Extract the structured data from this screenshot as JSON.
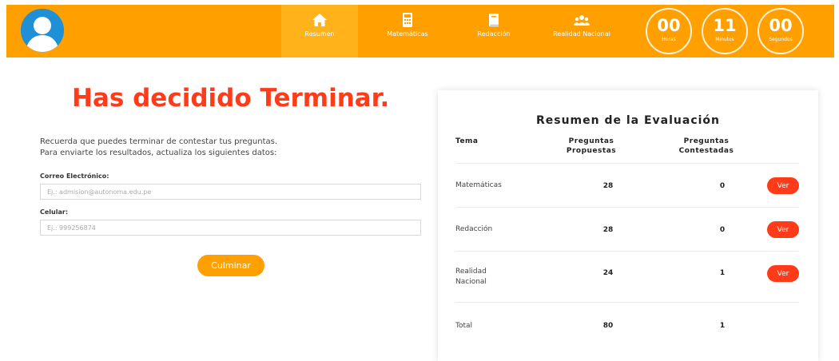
{
  "header": {
    "nav": [
      {
        "label": "Resumen",
        "icon": "home-icon"
      },
      {
        "label": "Matemáticas",
        "icon": "calculator-icon"
      },
      {
        "label": "Redacción",
        "icon": "book-icon"
      },
      {
        "label": "Realidad Nacional",
        "icon": "users-icon"
      }
    ],
    "timer": [
      {
        "value": "00",
        "unit": "Horas"
      },
      {
        "value": "11",
        "unit": "Minutos"
      },
      {
        "value": "00",
        "unit": "Segundos"
      }
    ]
  },
  "main": {
    "title": "Has decidido Terminar.",
    "intro_line1": "Recuerda que puedes terminar de contestar tus preguntas.",
    "intro_line2": "Para enviarte los resultados, actualiza los siguientes datos:",
    "email_label": "Correo Electrónico:",
    "email_placeholder": "Ej.: admision@autonoma.edu.pe",
    "phone_label": "Celular:",
    "phone_placeholder": "Ej.: 999256874",
    "submit_label": "Culminar"
  },
  "summary": {
    "title": "Resumen de la Evaluación",
    "col_tema": "Tema",
    "col_propuestas": "Preguntas Propuestas",
    "col_contestadas": "Preguntas Contestadas",
    "rows": [
      {
        "tema": "Matemáticas",
        "propuestas": "28",
        "contestadas": "0",
        "action": "Ver"
      },
      {
        "tema": "Redacción",
        "propuestas": "28",
        "contestadas": "0",
        "action": "Ver"
      },
      {
        "tema": "Realidad Nacional",
        "propuestas": "24",
        "contestadas": "1",
        "action": "Ver"
      },
      {
        "tema": "Total",
        "propuestas": "80",
        "contestadas": "1"
      }
    ]
  },
  "colors": {
    "bar": "#ff9f00",
    "accent_red": "#ff3b1a",
    "avatar_blue": "#1f8fd6"
  }
}
